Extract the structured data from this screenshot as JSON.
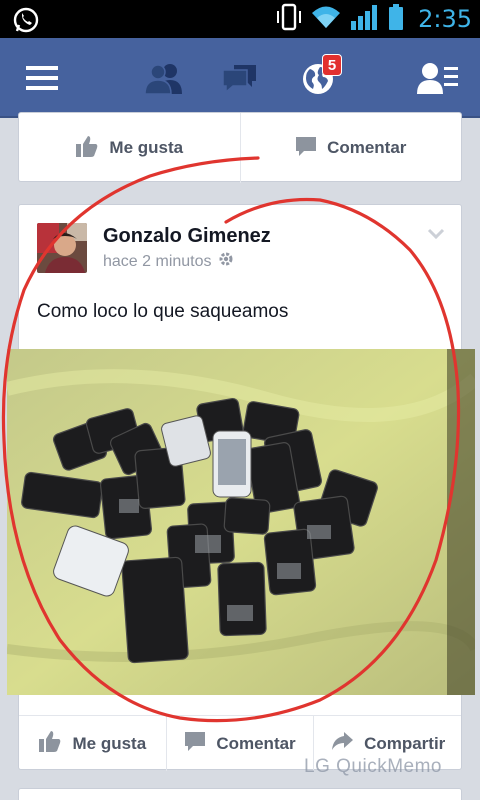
{
  "status_bar": {
    "time": "2:35",
    "icons": [
      "whatsapp-icon",
      "vibrate-icon",
      "wifi-icon",
      "signal-icon",
      "battery-icon"
    ]
  },
  "nav": {
    "icons": [
      "menu-icon",
      "friend-requests-icon",
      "messages-icon",
      "notifications-globe-icon",
      "contacts-icon"
    ],
    "notification_count": "5",
    "colors": {
      "bar": "#46629e",
      "badge": "#e2302f"
    }
  },
  "previous_post": {
    "actions": {
      "like": "Me gusta",
      "comment": "Comentar"
    }
  },
  "post": {
    "author": "Gonzalo Gimenez",
    "time": "hace 2 minutos",
    "text": "Como loco lo que saqueamos",
    "actions": {
      "like": "Me gusta",
      "comment": "Comentar",
      "share": "Compartir"
    }
  },
  "watermark": "LG QuickMemo",
  "annotation_color": "#e0352f"
}
